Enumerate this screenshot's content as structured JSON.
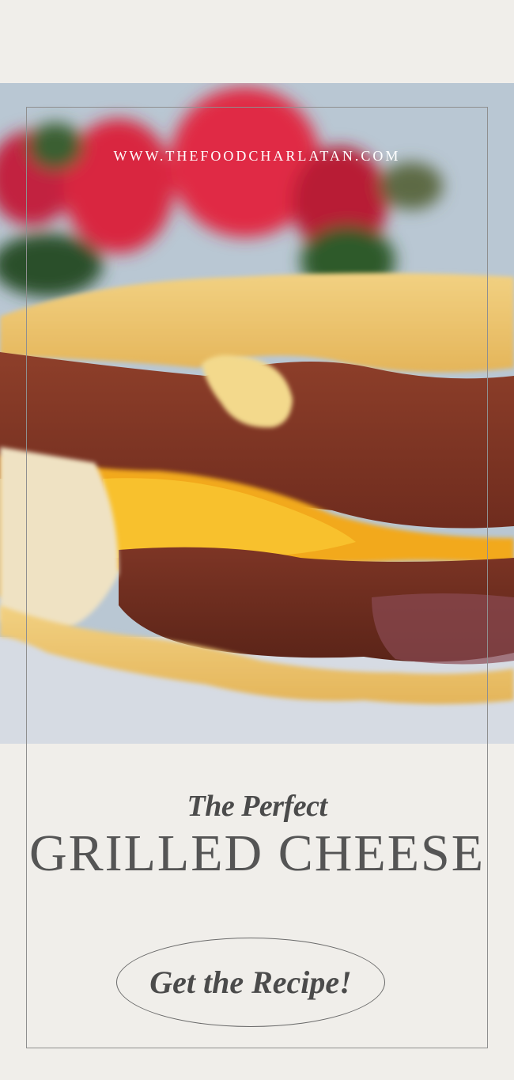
{
  "site": {
    "url": "WWW.THEFOODCHARLATAN.COM"
  },
  "headline": {
    "subtitle": "The Perfect",
    "title": "GRILLED CHEESE"
  },
  "cta": {
    "label": "Get the Recipe!"
  },
  "colors": {
    "page_background": "#f0eeea",
    "text": "#555555",
    "frame": "#8f8f8f"
  }
}
